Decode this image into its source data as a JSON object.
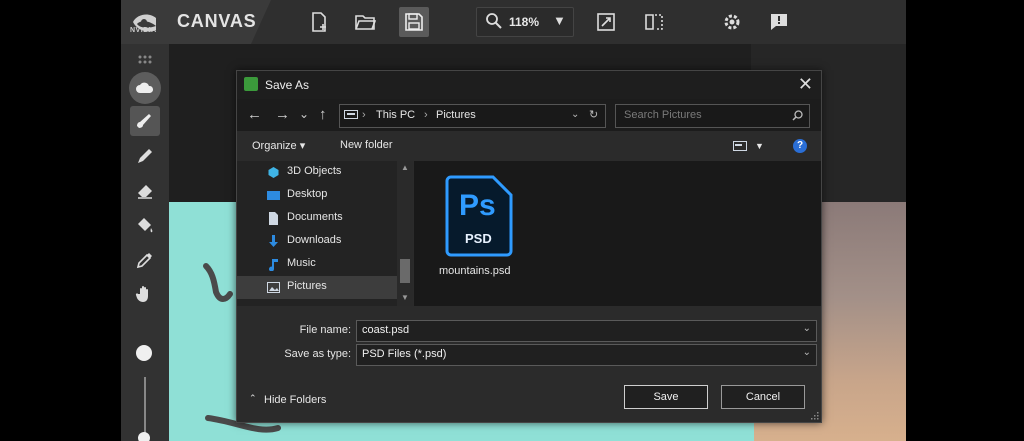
{
  "app": {
    "brand_word": "NVIDIA",
    "title": "CANVAS",
    "zoom": "118%",
    "zoom_chevron": "▼",
    "toolbar_icons": [
      "new-file-icon",
      "open-folder-icon",
      "save-icon",
      "search-icon",
      "fit-view-icon",
      "mirror-icon",
      "gear-icon",
      "feedback-icon"
    ],
    "left_tools": [
      "grid-icon",
      "cloud-icon",
      "brush-icon",
      "pen-icon",
      "eraser-icon",
      "fill-icon",
      "eyedropper-icon",
      "hand-icon"
    ]
  },
  "dialog": {
    "title": "Save As",
    "close": "✕",
    "nav": {
      "back": "←",
      "forward": "→",
      "down": "⌄",
      "up": "↑"
    },
    "breadcrumb": [
      "This PC",
      "Pictures"
    ],
    "breadcrumb_sep": "›",
    "search_placeholder": "Search Pictures",
    "organize": "Organize ▾",
    "new_folder": "New folder",
    "help": "?",
    "sidebar": [
      {
        "label": "3D Objects",
        "icon": "3d-objects-icon",
        "color": "#3fb4e6"
      },
      {
        "label": "Desktop",
        "icon": "desktop-icon",
        "color": "#2d8be0"
      },
      {
        "label": "Documents",
        "icon": "documents-icon",
        "color": "#cfd8e3"
      },
      {
        "label": "Downloads",
        "icon": "downloads-icon",
        "color": "#2d8be0"
      },
      {
        "label": "Music",
        "icon": "music-icon",
        "color": "#2d8be0"
      },
      {
        "label": "Pictures",
        "icon": "pictures-icon",
        "color": "#cfd8e3",
        "selected": true
      }
    ],
    "files": [
      {
        "name": "mountains.psd",
        "type_badge": "Ps",
        "type_label": "PSD"
      }
    ],
    "file_name_label": "File name:",
    "file_name_value": "coast.psd",
    "save_type_label": "Save as type:",
    "save_type_value": "PSD Files (*.psd)",
    "hide_folders": "Hide Folders",
    "save_button": "Save",
    "cancel_button": "Cancel"
  },
  "colors": {
    "accent_ps": "#2f9bff",
    "canvas_teal": "#8fe0d6"
  }
}
